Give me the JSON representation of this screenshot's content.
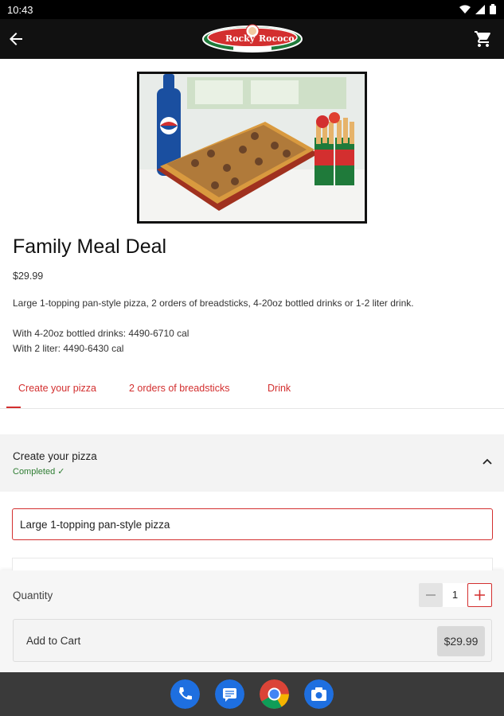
{
  "status_bar": {
    "time": "10:43",
    "icons": [
      "wifi-icon",
      "signal-icon",
      "battery-icon"
    ]
  },
  "app_bar": {
    "back_icon": "arrow-left-icon",
    "cart_icon": "cart-icon",
    "logo_text": "Rocky Rococo"
  },
  "product": {
    "title": "Family Meal Deal",
    "price": "$29.99",
    "description": "Large 1-topping pan-style pizza, 2 orders of breadsticks, 4-20oz bottled drinks or 1-2 liter drink.",
    "calories_drinks": "With 4-20oz bottled drinks: 4490-6710 cal",
    "calories_liter": "With 2 liter: 4490-6430 cal"
  },
  "tabs": [
    {
      "label": "Create your pizza",
      "active": true
    },
    {
      "label": "2 orders of breadsticks",
      "active": false
    },
    {
      "label": "Drink",
      "active": false
    }
  ],
  "section": {
    "title": "Create your pizza",
    "status": "Completed ✓"
  },
  "option": {
    "label": "Large 1-topping pan-style pizza"
  },
  "footer": {
    "quantity_label": "Quantity",
    "quantity_value": "1",
    "add_to_cart_label": "Add to Cart",
    "add_to_cart_price": "$29.99"
  },
  "dock": {
    "apps": [
      "phone-icon",
      "messages-icon",
      "chrome-icon",
      "camera-icon"
    ]
  },
  "colors": {
    "accent": "#d32f2f",
    "success": "#2e7d32",
    "app_bar": "#111111"
  }
}
